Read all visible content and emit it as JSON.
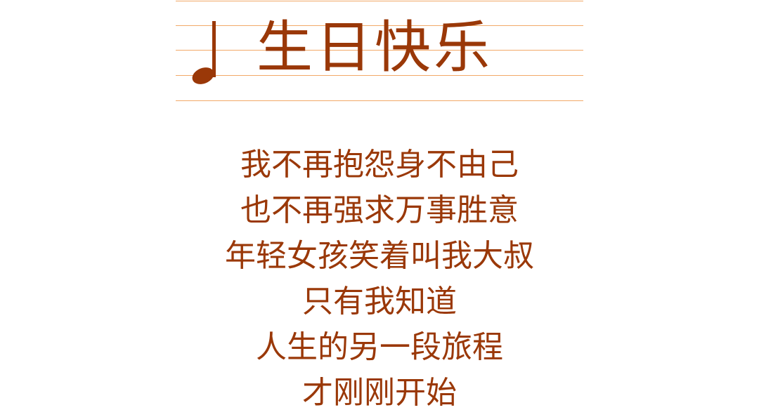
{
  "header": {
    "title": "生日快乐",
    "icon": "music-note-icon"
  },
  "poem": {
    "lines": [
      "我不再抱怨身不由己",
      "也不再强求万事胜意",
      "年轻女孩笑着叫我大叔",
      "只有我知道",
      "人生的另一段旅程",
      "才刚刚开始"
    ]
  },
  "colors": {
    "text": "#9a3808",
    "staff_line": "#f2a968",
    "background": "#ffffff"
  }
}
